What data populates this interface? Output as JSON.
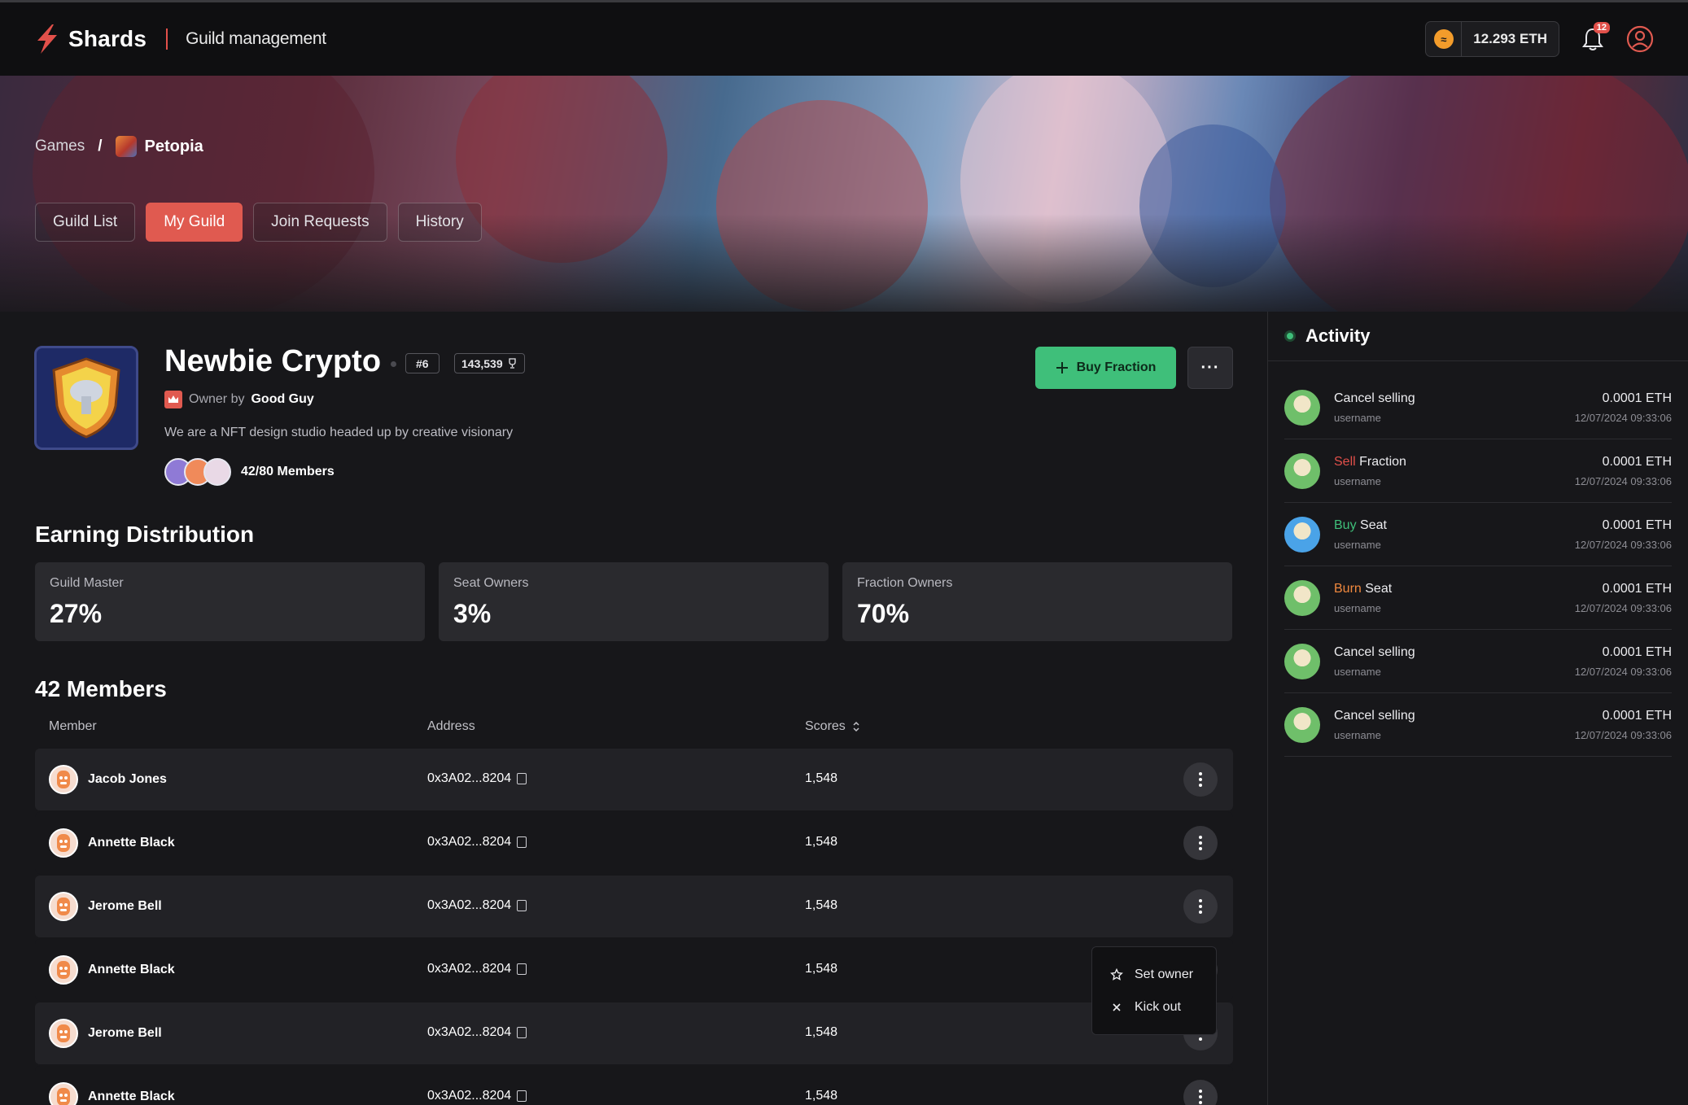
{
  "header": {
    "brand": "Shards",
    "subtitle": "Guild management",
    "wallet_amount": "12.293 ETH",
    "notification_count": "12"
  },
  "breadcrumb": {
    "root": "Games",
    "separator": "/",
    "current": "Petopia"
  },
  "tabs": [
    {
      "label": "Guild List",
      "active": false
    },
    {
      "label": "My Guild",
      "active": true
    },
    {
      "label": "Join Requests",
      "active": false
    },
    {
      "label": "History",
      "active": false
    }
  ],
  "guild": {
    "name": "Newbie Crypto",
    "rank": "#6",
    "score": "143,539",
    "owner_prefix": "Owner by",
    "owner_name": "Good Guy",
    "description": "We are a NFT design studio headed up by creative visionary",
    "members_count": "42/80 Members",
    "buy_label": "Buy Fraction",
    "more_label": "···"
  },
  "earnings": {
    "title": "Earning Distribution",
    "cards": [
      {
        "label": "Guild Master",
        "value": "27%"
      },
      {
        "label": "Seat Owners",
        "value": "3%"
      },
      {
        "label": "Fraction Owners",
        "value": "70%"
      }
    ]
  },
  "members": {
    "title": "42 Members",
    "columns": {
      "member": "Member",
      "address": "Address",
      "scores": "Scores"
    },
    "rows": [
      {
        "name": "Jacob Jones",
        "address": "0x3A02...8204",
        "score": "1,548"
      },
      {
        "name": "Annette Black",
        "address": "0x3A02...8204",
        "score": "1,548"
      },
      {
        "name": "Jerome Bell",
        "address": "0x3A02...8204",
        "score": "1,548"
      },
      {
        "name": "Annette Black",
        "address": "0x3A02...8204",
        "score": "1,548"
      },
      {
        "name": "Jerome Bell",
        "address": "0x3A02...8204",
        "score": "1,548"
      },
      {
        "name": "Annette Black",
        "address": "0x3A02...8204",
        "score": "1,548"
      }
    ]
  },
  "row_menu": {
    "items": [
      {
        "label": "Set owner",
        "icon": "star-icon"
      },
      {
        "label": "Kick out",
        "icon": "close-icon"
      }
    ]
  },
  "activity": {
    "title": "Activity",
    "items": [
      {
        "verb": "",
        "verb_color": "",
        "object": "Cancel selling",
        "user": "username",
        "amount": "0.0001 ETH",
        "date": "12/07/2024 09:33:06"
      },
      {
        "verb": "Sell",
        "verb_color": "#e2504a",
        "object": "Fraction",
        "user": "username",
        "amount": "0.0001 ETH",
        "date": "12/07/2024 09:33:06"
      },
      {
        "verb": "Buy",
        "verb_color": "#3fbf7a",
        "object": "Seat",
        "user": "username",
        "amount": "0.0001 ETH",
        "date": "12/07/2024 09:33:06"
      },
      {
        "verb": "Burn",
        "verb_color": "#f0883e",
        "object": "Seat",
        "user": "username",
        "amount": "0.0001 ETH",
        "date": "12/07/2024 09:33:06"
      },
      {
        "verb": "",
        "verb_color": "",
        "object": "Cancel selling",
        "user": "username",
        "amount": "0.0001 ETH",
        "date": "12/07/2024 09:33:06"
      },
      {
        "verb": "",
        "verb_color": "",
        "object": "Cancel selling",
        "user": "username",
        "amount": "0.0001 ETH",
        "date": "12/07/2024 09:33:06"
      }
    ]
  },
  "colors": {
    "accent": "#e05a50",
    "success": "#3fbf7a",
    "background": "#17171a"
  }
}
